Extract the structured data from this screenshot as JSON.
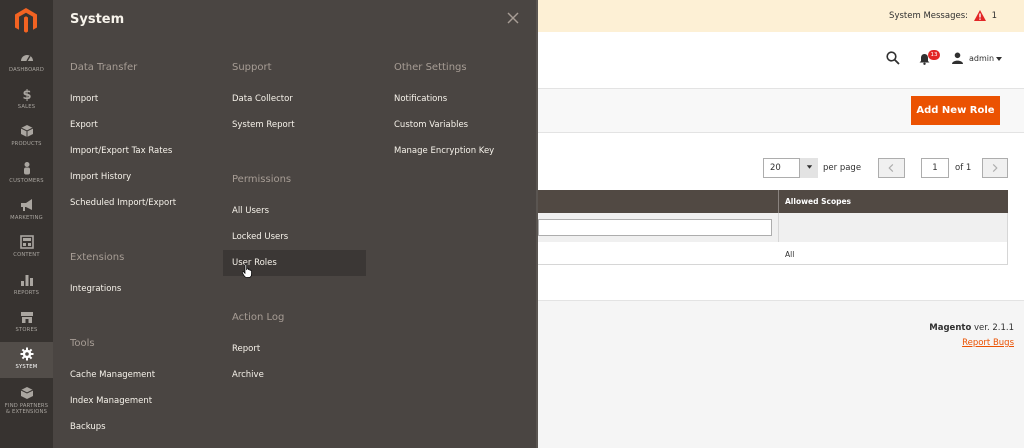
{
  "nav": {
    "items": [
      {
        "label": "DASHBOARD",
        "icon": "dashboard-icon"
      },
      {
        "label": "SALES",
        "icon": "dollar-icon"
      },
      {
        "label": "PRODUCTS",
        "icon": "cube-icon"
      },
      {
        "label": "CUSTOMERS",
        "icon": "person-icon"
      },
      {
        "label": "MARKETING",
        "icon": "megaphone-icon"
      },
      {
        "label": "CONTENT",
        "icon": "layout-icon"
      },
      {
        "label": "REPORTS",
        "icon": "bar-chart-icon"
      },
      {
        "label": "STORES",
        "icon": "store-icon"
      },
      {
        "label": "SYSTEM",
        "icon": "gear-icon",
        "active": true
      },
      {
        "label": "FIND PARTNERS & EXTENSIONS",
        "label_line1": "FIND PARTNERS",
        "label_line2": "& EXTENSIONS",
        "icon": "box-icon"
      }
    ]
  },
  "flyout": {
    "title": "System",
    "columns": {
      "data_transfer": {
        "heading": "Data Transfer",
        "links": [
          "Import",
          "Export",
          "Import/Export Tax Rates",
          "Import History",
          "Scheduled Import/Export"
        ]
      },
      "extensions": {
        "heading": "Extensions",
        "links": [
          "Integrations"
        ]
      },
      "tools": {
        "heading": "Tools",
        "links": [
          "Cache Management",
          "Index Management",
          "Backups"
        ]
      },
      "support": {
        "heading": "Support",
        "links": [
          "Data Collector",
          "System Report"
        ]
      },
      "permissions": {
        "heading": "Permissions",
        "links": [
          "All Users",
          "Locked Users",
          "User Roles"
        ]
      },
      "action_log": {
        "heading": "Action Log",
        "links": [
          "Report",
          "Archive"
        ]
      },
      "other_settings": {
        "heading": "Other Settings",
        "links": [
          "Notifications",
          "Custom Variables",
          "Manage Encryption Key"
        ]
      }
    }
  },
  "system_messages": {
    "label": "System Messages:",
    "count": "1"
  },
  "header": {
    "notifications_count": "13",
    "user": "admin"
  },
  "actions": {
    "add_new_role": "Add New Role"
  },
  "pager": {
    "per_page_value": "20",
    "per_page_label": "per page",
    "page": "1",
    "of_label": "of 1"
  },
  "grid": {
    "columns": [
      "Allowed Scopes"
    ],
    "rows": [
      {
        "allowed_scopes": "All"
      }
    ]
  },
  "footer": {
    "brand": "Magento",
    "version": " ver. 2.1.1",
    "report_bugs": "Report Bugs"
  },
  "colors": {
    "accent": "#eb5202",
    "nav_bg": "#373330",
    "flyout_bg": "#4a4542",
    "grid_header": "#514943"
  }
}
